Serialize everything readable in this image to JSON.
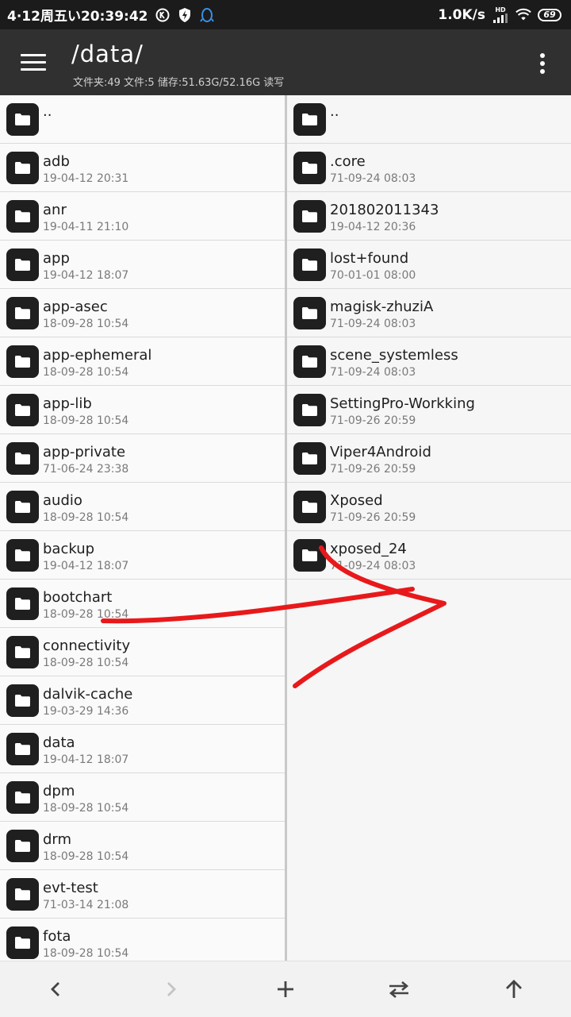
{
  "status_bar": {
    "datetime": "4·12周五い20:39:42",
    "net_speed": "1.0K/s",
    "signal_label": "HD",
    "battery": "69",
    "icons": [
      "k-circle-icon",
      "shield-bolt-icon",
      "qq-penguin-icon",
      "signal-icon",
      "wifi-icon",
      "battery-icon"
    ]
  },
  "app_bar": {
    "path": "/data/",
    "info": "文件夹:49 文件:5 储存:51.63G/52.16G 读写",
    "icons": [
      "menu-icon",
      "more-vert-icon"
    ]
  },
  "left_pane": {
    "items": [
      {
        "name": "..",
        "date": ""
      },
      {
        "name": "adb",
        "date": "19-04-12 20:31"
      },
      {
        "name": "anr",
        "date": "19-04-11 21:10"
      },
      {
        "name": "app",
        "date": "19-04-12 18:07"
      },
      {
        "name": "app-asec",
        "date": "18-09-28 10:54"
      },
      {
        "name": "app-ephemeral",
        "date": "18-09-28 10:54"
      },
      {
        "name": "app-lib",
        "date": "18-09-28 10:54"
      },
      {
        "name": "app-private",
        "date": "71-06-24 23:38"
      },
      {
        "name": "audio",
        "date": "18-09-28 10:54"
      },
      {
        "name": "backup",
        "date": "19-04-12 18:07"
      },
      {
        "name": "bootchart",
        "date": "18-09-28 10:54"
      },
      {
        "name": "connectivity",
        "date": "18-09-28 10:54"
      },
      {
        "name": "dalvik-cache",
        "date": "19-03-29 14:36"
      },
      {
        "name": "data",
        "date": "19-04-12 18:07"
      },
      {
        "name": "dpm",
        "date": "18-09-28 10:54"
      },
      {
        "name": "drm",
        "date": "18-09-28 10:54"
      },
      {
        "name": "evt-test",
        "date": "71-03-14 21:08"
      },
      {
        "name": "fota",
        "date": "18-09-28 10:54"
      }
    ]
  },
  "right_pane": {
    "items": [
      {
        "name": "..",
        "date": ""
      },
      {
        "name": ".core",
        "date": "71-09-24 08:03"
      },
      {
        "name": "201802011343",
        "date": "19-04-12 20:36"
      },
      {
        "name": "lost+found",
        "date": "70-01-01 08:00"
      },
      {
        "name": "magisk-zhuziA",
        "date": "71-09-24 08:03"
      },
      {
        "name": "scene_systemless",
        "date": "71-09-24 08:03"
      },
      {
        "name": "SettingPro-Workking",
        "date": "71-09-26 20:59"
      },
      {
        "name": "Viper4Android",
        "date": "71-09-26 20:59"
      },
      {
        "name": "Xposed",
        "date": "71-09-26 20:59"
      },
      {
        "name": "xposed_24",
        "date": "71-09-24 08:03"
      }
    ]
  },
  "bottom_bar": {
    "icons": [
      "back-arrow-icon",
      "forward-arrow-icon",
      "add-icon",
      "swap-icon",
      "up-arrow-icon"
    ]
  },
  "colors": {
    "app_bar": "#303030",
    "status_bar": "#1b1b1b",
    "folder_icon": "#1f1f1f",
    "annotation": "#e8191b"
  }
}
